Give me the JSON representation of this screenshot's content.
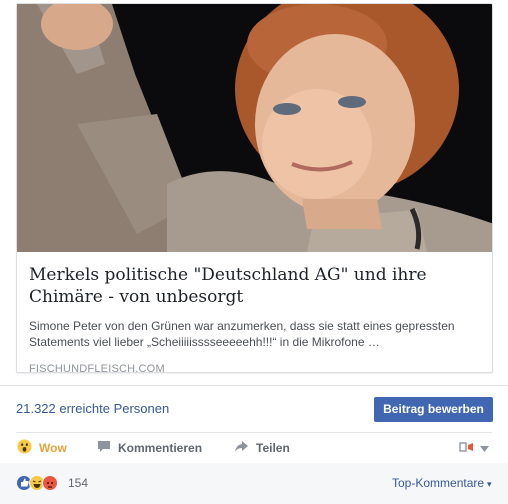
{
  "post": {
    "headline": "Merkels politische \"Deutschland AG\" und ihre Chimäre - von unbesorgt",
    "description": "Simone Peter von den Grünen war anzumerken, dass sie statt eines gepressten Statements viel lieber „Scheiiiiisssseeeeehh!!!“ in die Mikrofone …",
    "domain": "FISCHUNDFLEISCH.COM"
  },
  "stats": {
    "reach": "21.322 erreichte Personen",
    "boost_label": "Beitrag bewerben"
  },
  "actions": {
    "wow": "Wow",
    "comment": "Kommentieren",
    "share": "Teilen"
  },
  "reactions": {
    "count": "154",
    "sort_label": "Top-Kommentare",
    "colors": {
      "like": "#4267b2",
      "haha": "#f7c945",
      "angry": "#e9573f"
    }
  }
}
